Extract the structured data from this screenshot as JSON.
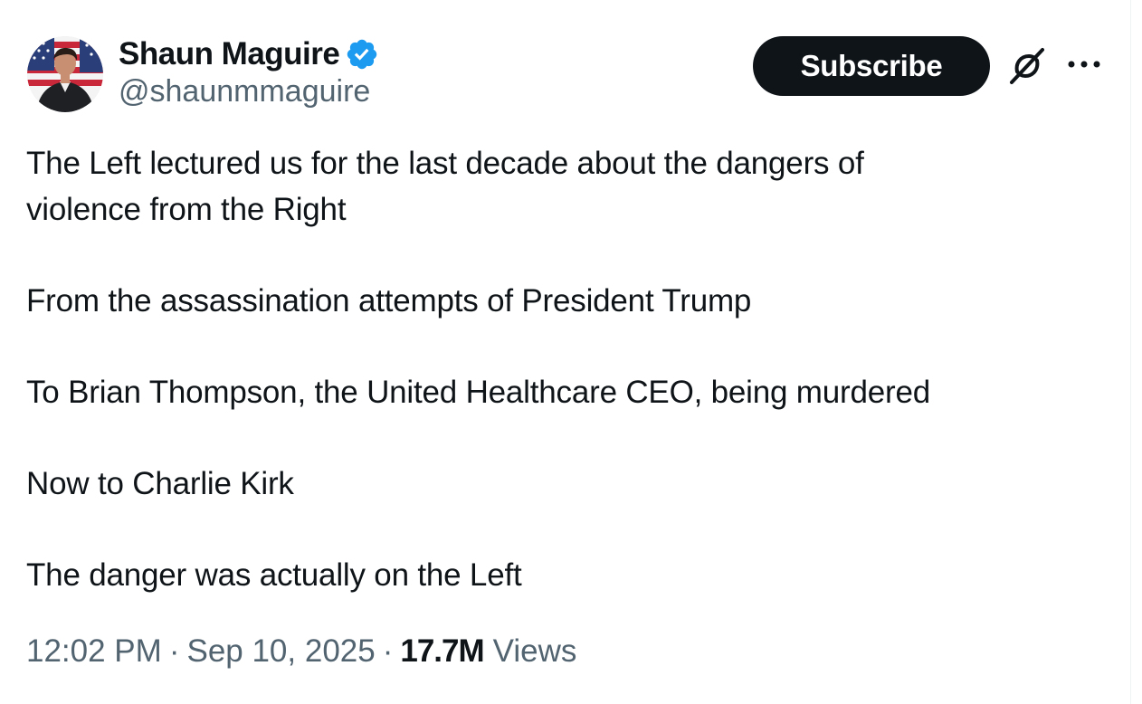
{
  "author": {
    "display_name": "Shaun Maguire",
    "handle": "@shaunmmaguire",
    "verified_color": "#1d9bf0"
  },
  "actions": {
    "subscribe_label": "Subscribe",
    "grok_icon": "grok-icon",
    "more_icon": "more-icon"
  },
  "tweet": {
    "lines": [
      "The Left lectured us for the last decade about the dangers of",
      "violence from the Right",
      "From the assassination attempts of President Trump",
      "To Brian Thompson, the United Healthcare CEO, being murdered",
      "Now to Charlie Kirk",
      "The danger was actually on the Left"
    ]
  },
  "meta": {
    "time": "12:02 PM",
    "separator": "·",
    "date": "Sep 10, 2025",
    "views_count": "17.7M",
    "views_label": "Views"
  },
  "colors": {
    "text": "#0f1419",
    "secondary": "#536471",
    "button_bg": "#0f1419",
    "button_text": "#ffffff"
  }
}
